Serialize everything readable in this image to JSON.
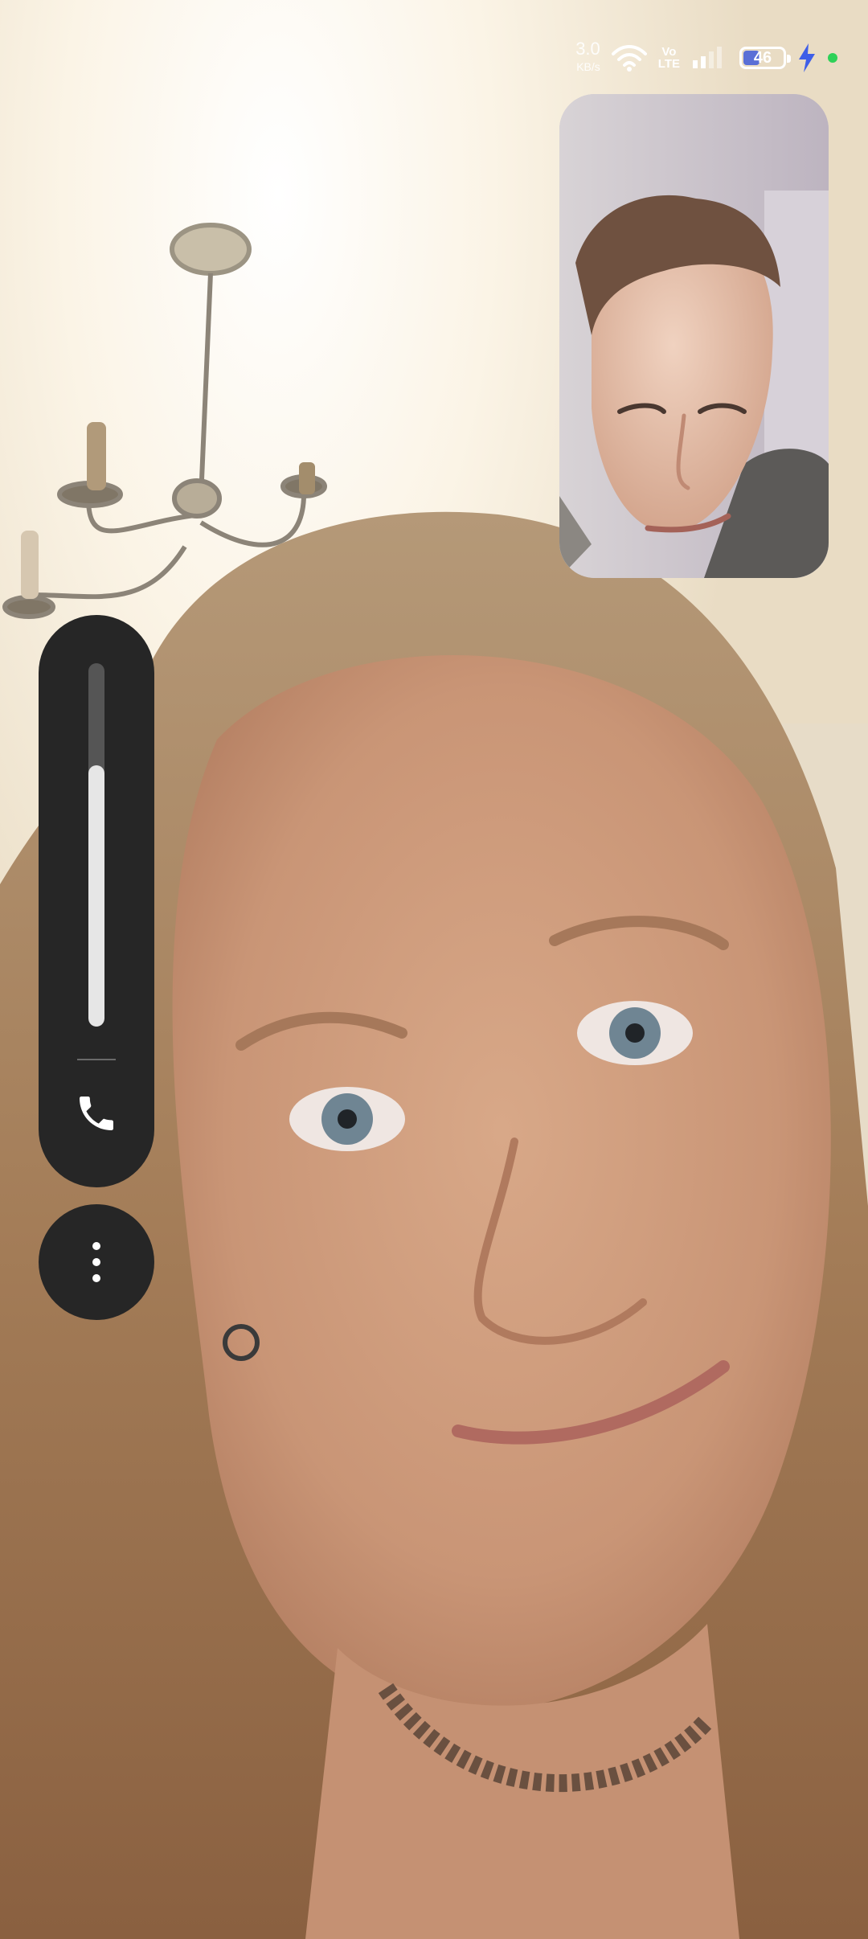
{
  "status_bar": {
    "network_speed": "3.0",
    "network_speed_unit": "KB/s",
    "wifi_icon": "wifi-icon",
    "volte_label_top": "Vo",
    "volte_label_bottom": "LTE",
    "signal_icon": "signal-bars-icon",
    "battery_level": "46",
    "battery_fill_percent": 46,
    "battery_color": "#5a6fd6",
    "charging_icon": "lightning-bolt-icon",
    "charging_color": "#3e5ee8",
    "status_dot_color": "#2ed158"
  },
  "remote_video": {
    "content": "remote-participant-video"
  },
  "self_preview": {
    "content": "local-camera-preview"
  },
  "controls": {
    "volume_level_percent": 72,
    "volume_track_color": "#555555",
    "volume_fill_color": "#e6e6e6",
    "audio_output_icon": "phone-handset-icon",
    "more_options_icon": "more-vertical-icon",
    "panel_color": "#262626"
  }
}
